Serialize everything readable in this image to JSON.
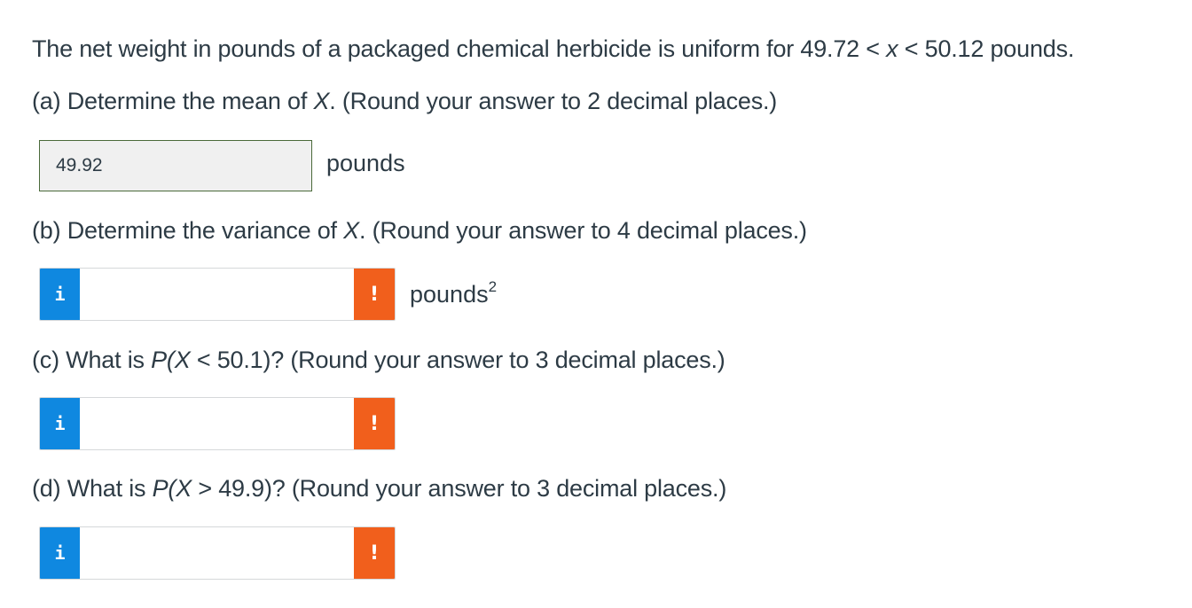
{
  "intro": {
    "prefix": "The net weight in pounds of a packaged chemical herbicide is uniform for 49.72 < ",
    "var": "x",
    "suffix": " < 50.12 pounds."
  },
  "part_a": {
    "prefix": "(a) Determine the mean of ",
    "var": "X",
    "suffix": ". (Round your answer to 2 decimal places.)",
    "answer_value": "49.92",
    "unit": "pounds"
  },
  "part_b": {
    "prefix": "(b) Determine the variance of ",
    "var": "X",
    "suffix": ". (Round your answer to 4 decimal places.)",
    "info_label": "i",
    "answer_value": "",
    "warn_label": "!",
    "unit": "pounds",
    "unit_sup": "2"
  },
  "part_c": {
    "prefix": "(c) What is ",
    "expr": "P(X",
    "suffix": " < 50.1)? (Round your answer to 3 decimal places.)",
    "info_label": "i",
    "answer_value": "",
    "warn_label": "!"
  },
  "part_d": {
    "prefix": "(d) What is ",
    "expr": "P(X",
    "suffix": " > 49.9)? (Round your answer to 3 decimal places.)",
    "info_label": "i",
    "answer_value": "",
    "warn_label": "!"
  },
  "colors": {
    "text": "#2d3b45",
    "info_blue": "#0f88e0",
    "warning_orange": "#f15f1c",
    "answered_border": "#4a6a3a",
    "answered_bg": "#f0f0f0"
  }
}
